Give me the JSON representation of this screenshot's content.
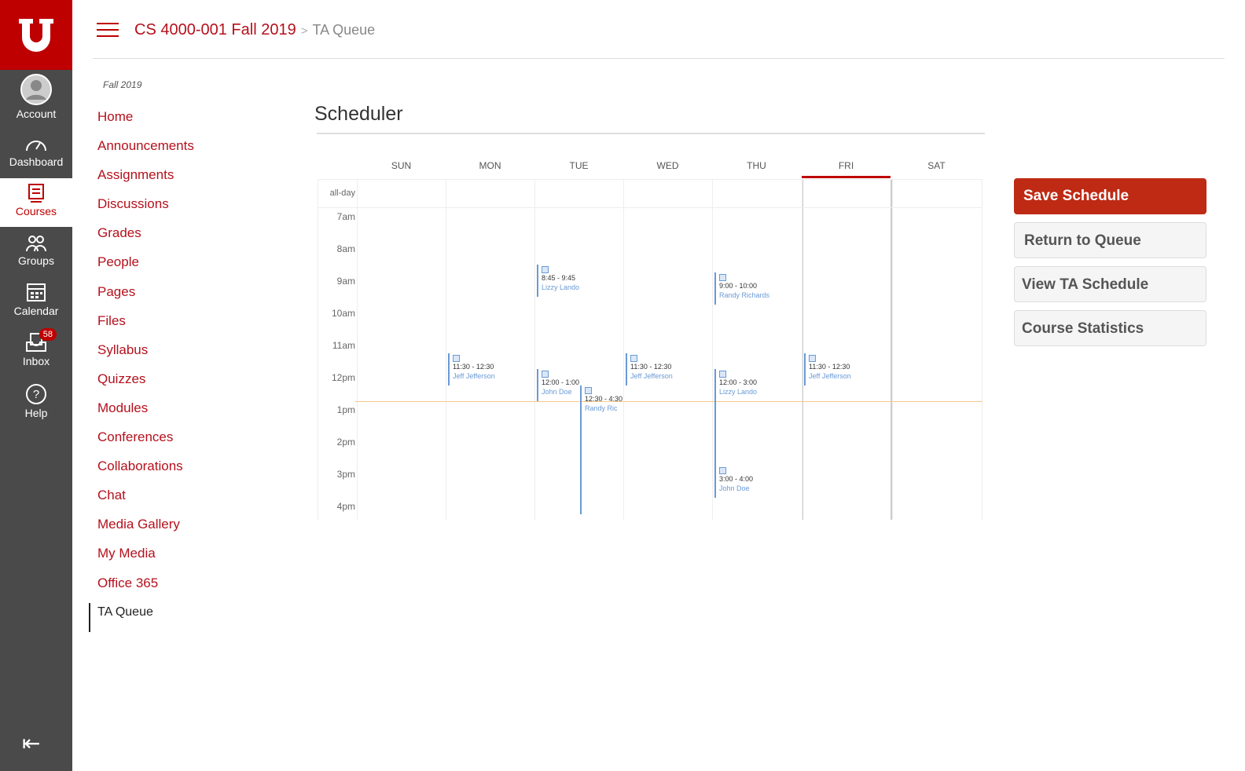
{
  "global_nav": {
    "logo": "U",
    "items": [
      {
        "label": "Account",
        "icon": "account-icon"
      },
      {
        "label": "Dashboard",
        "icon": "dashboard-icon"
      },
      {
        "label": "Courses",
        "icon": "courses-icon"
      },
      {
        "label": "Groups",
        "icon": "groups-icon"
      },
      {
        "label": "Calendar",
        "icon": "calendar-icon"
      },
      {
        "label": "Inbox",
        "icon": "inbox-icon",
        "badge": "58"
      },
      {
        "label": "Help",
        "icon": "help-icon"
      }
    ],
    "collapse_icon": "⇤"
  },
  "header": {
    "course": "CS 4000-001 Fall 2019",
    "separator": ">",
    "page": "TA Queue"
  },
  "course_nav": {
    "term": "Fall 2019",
    "items": [
      "Home",
      "Announcements",
      "Assignments",
      "Discussions",
      "Grades",
      "People",
      "Pages",
      "Files",
      "Syllabus",
      "Quizzes",
      "Modules",
      "Conferences",
      "Collaborations",
      "Chat",
      "Media Gallery",
      "My Media",
      "Office 365",
      "TA Queue"
    ]
  },
  "scheduler": {
    "title": "Scheduler",
    "days": [
      "SUN",
      "MON",
      "TUE",
      "WED",
      "THU",
      "FRI",
      "SAT"
    ],
    "allday_label": "all-day",
    "times": [
      "7am",
      "8am",
      "9am",
      "10am",
      "11am",
      "12pm",
      "1pm",
      "2pm",
      "3pm",
      "4pm"
    ],
    "events": [
      {
        "day": "MON",
        "time": "11:30 - 12:30",
        "name": "Jeff Jefferson"
      },
      {
        "day": "TUE",
        "time": "8:45 - 9:45",
        "name": "Lizzy Lando"
      },
      {
        "day": "TUE",
        "time": "12:00 - 1:00",
        "name": "John Doe"
      },
      {
        "day": "TUE",
        "time": "12:30 - 4:30",
        "name": "Randy Ric"
      },
      {
        "day": "WED",
        "time": "11:30 - 12:30",
        "name": "Jeff Jefferson"
      },
      {
        "day": "THU",
        "time": "9:00 - 10:00",
        "name": "Randy Richards"
      },
      {
        "day": "THU",
        "time": "12:00 - 3:00",
        "name": "Lizzy Lando"
      },
      {
        "day": "THU",
        "time": "3:00 - 4:00",
        "name": "John Doe"
      },
      {
        "day": "FRI",
        "time": "11:30 - 12:30",
        "name": "Jeff Jefferson"
      }
    ]
  },
  "actions": {
    "save": "Save Schedule",
    "return": "Return to Queue",
    "view_ta": "View TA Schedule",
    "stats": "Course Statistics"
  },
  "colors": {
    "brand": "#be0000",
    "event": "#6a9ad6"
  }
}
